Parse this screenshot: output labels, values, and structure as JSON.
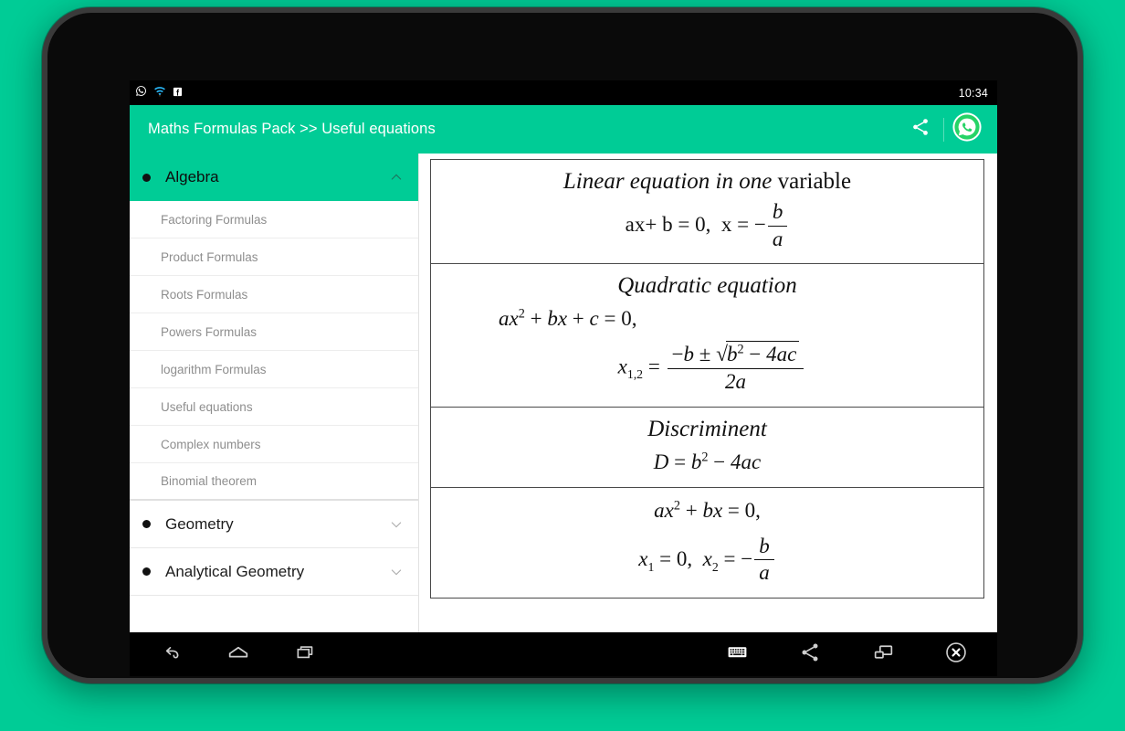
{
  "theme": {
    "accent": "#00cc96",
    "page_background": "#00cc96",
    "bezel": "#3a3a3a",
    "status_bar_background": "#000000",
    "nav_bar_background": "#000000",
    "sidebar_text": "#8e8e8e",
    "wifi_icon_color": "#29b6f6"
  },
  "status_bar": {
    "icons": [
      {
        "name": "whatsapp-notification-icon"
      },
      {
        "name": "wifi-icon"
      },
      {
        "name": "facebook-notification-icon"
      }
    ],
    "time": "10:34"
  },
  "app_bar": {
    "title": "Maths Formulas Pack >> Useful equations",
    "actions": [
      {
        "name": "share-button",
        "icon": "share-icon"
      },
      {
        "name": "whatsapp-share-button",
        "icon": "whatsapp-icon"
      }
    ]
  },
  "sidebar": {
    "groups": [
      {
        "label": "Algebra",
        "expanded": true,
        "active": true,
        "chevron": "chevron-up-icon",
        "items": [
          {
            "label": "Factoring Formulas",
            "selected": false
          },
          {
            "label": "Product Formulas",
            "selected": false
          },
          {
            "label": "Roots Formulas",
            "selected": false
          },
          {
            "label": "Powers Formulas",
            "selected": false
          },
          {
            "label": "logarithm Formulas",
            "selected": false
          },
          {
            "label": "Useful equations",
            "selected": true
          },
          {
            "label": "Complex numbers",
            "selected": false
          },
          {
            "label": "Binomial theorem",
            "selected": false
          }
        ]
      },
      {
        "label": "Geometry",
        "expanded": false,
        "active": false,
        "chevron": "chevron-down-icon",
        "items": []
      },
      {
        "label": "Analytical Geometry",
        "expanded": false,
        "active": false,
        "chevron": "chevron-down-icon",
        "items": []
      }
    ]
  },
  "formulas": {
    "rows": [
      {
        "heading_italic": "Linear equation in one ",
        "heading_upright": "variable",
        "equation_text": "ax+ b = 0,  x = -b/a"
      },
      {
        "heading_italic": "Quadratic equation",
        "heading_upright": "",
        "equation_line1": "ax² + bx + c = 0,",
        "equation_line2": "x₁,₂ = (-b ± √(b² - 4ac)) / 2a"
      },
      {
        "heading_italic": "Discriminent",
        "heading_upright": "",
        "equation_text": "D = b² - 4ac"
      },
      {
        "heading_italic": "",
        "heading_upright": "",
        "equation_line1": "ax² + bx = 0,",
        "equation_line2": "x₁ = 0,  x₂ = -b/a"
      }
    ],
    "symbols": {
      "a": "a",
      "b": "b",
      "c": "c",
      "x": "x",
      "D": "D",
      "zero": "0",
      "two": "2",
      "four": "4",
      "eq": "=",
      "plus": "+",
      "minus": "−",
      "plusminus": "±",
      "comma": ",",
      "sub_1": "1",
      "sub_2": "2",
      "sub_12": "1,2",
      "exp_2": "2",
      "ax_upright": "ax",
      "b_upright": "b",
      "x_upright": "x",
      "radical_sign": "√",
      "four_ac": "4ac",
      "two_a": "2a",
      "bx": "bx"
    }
  },
  "nav_bar": {
    "left_buttons": [
      {
        "name": "back-button",
        "icon": "back-arrow-icon"
      },
      {
        "name": "home-button",
        "icon": "home-icon"
      },
      {
        "name": "recent-apps-button",
        "icon": "recent-apps-icon"
      }
    ],
    "right_buttons": [
      {
        "name": "keyboard-button",
        "icon": "keyboard-icon"
      },
      {
        "name": "share-button",
        "icon": "share-icon"
      },
      {
        "name": "cast-button",
        "icon": "cast-screen-icon"
      },
      {
        "name": "close-button",
        "icon": "close-circle-icon"
      }
    ]
  }
}
